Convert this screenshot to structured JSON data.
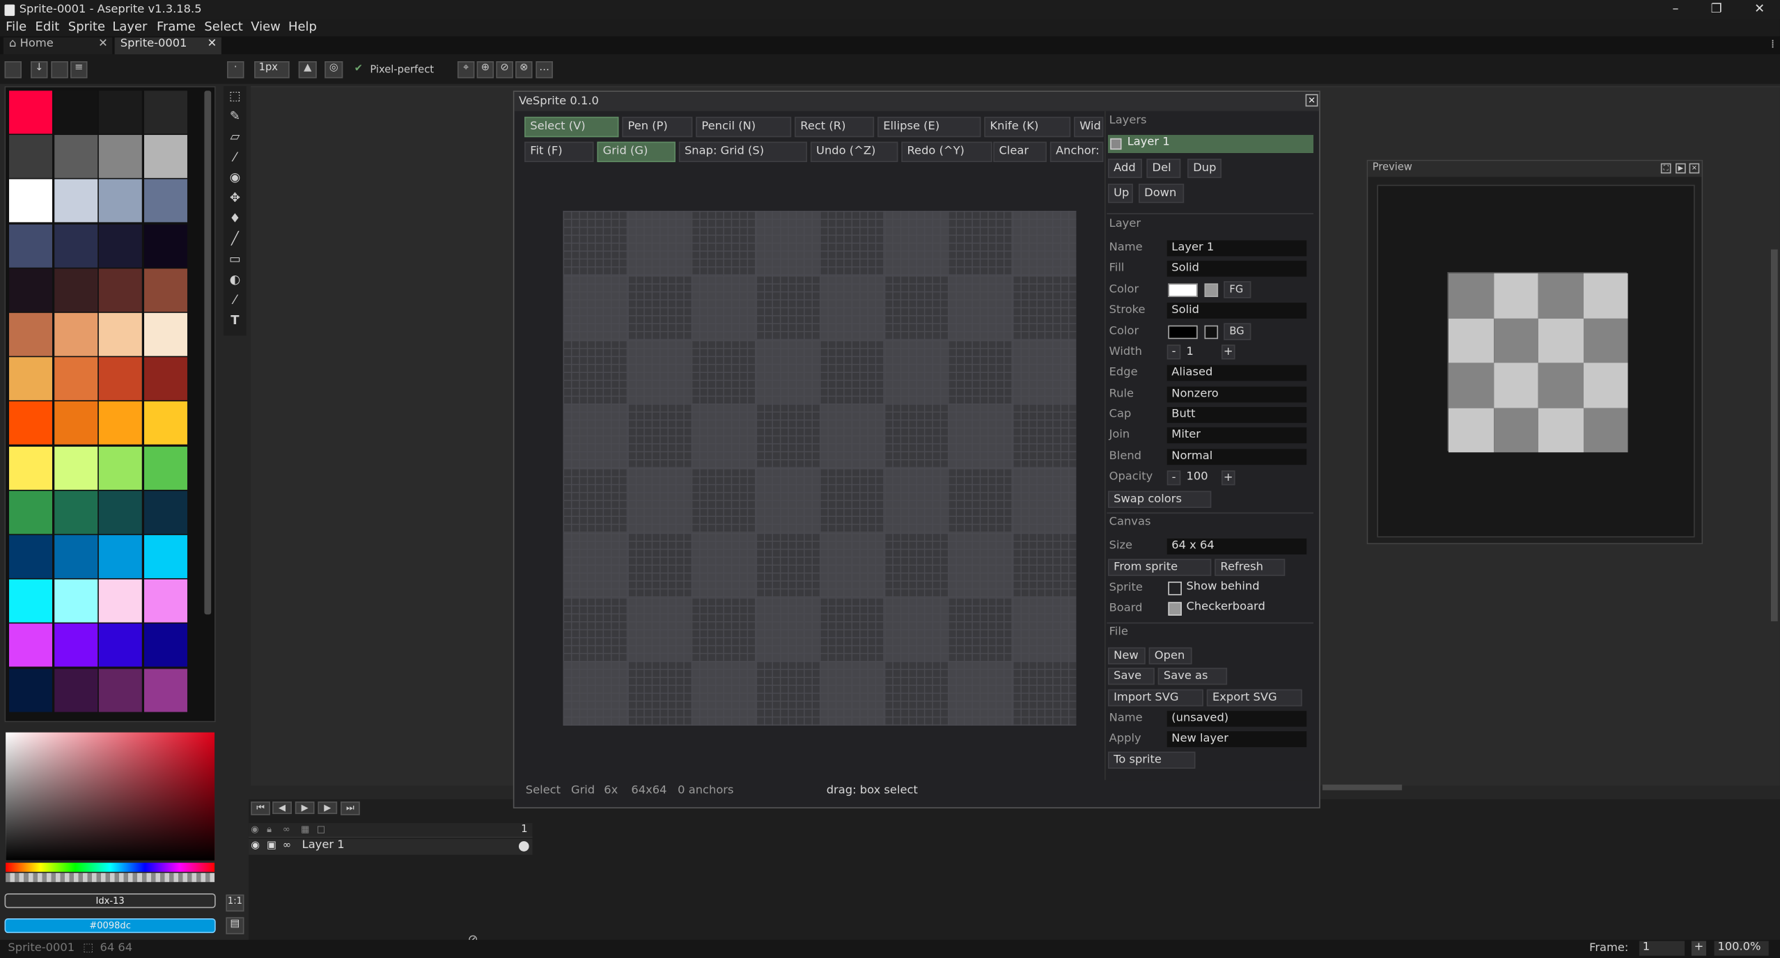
{
  "window": {
    "title": "Sprite-0001 - Aseprite v1.3.18.5",
    "controls": [
      "–",
      "❐",
      "✕"
    ]
  },
  "menu": [
    "File",
    "Edit",
    "Sprite",
    "Layer",
    "Frame",
    "Select",
    "View",
    "Help"
  ],
  "tabs": [
    {
      "label": "Home",
      "icon": "home-icon"
    },
    {
      "label": "Sprite-0001"
    }
  ],
  "toolbar": {
    "brush_size": "1px",
    "pixel_perfect_label": "Pixel-perfect"
  },
  "palette": [
    "#ff0040",
    "#131313",
    "#1b1b1b",
    "#272727",
    "#3d3d3d",
    "#5d5d5d",
    "#858585",
    "#b4b4b4",
    "#ffffff",
    "#c7cfdd",
    "#92a1b9",
    "#657392",
    "#424c6e",
    "#2a2f4e",
    "#1a1932",
    "#0e071b",
    "#1c121c",
    "#391f21",
    "#5d2c28",
    "#8a4836",
    "#bf6f4a",
    "#e69c69",
    "#f6ca9f",
    "#f9e6cf",
    "#edab50",
    "#e07438",
    "#c64524",
    "#8e251d",
    "#ff5000",
    "#ed7614",
    "#ffa214",
    "#ffc825",
    "#ffeb57",
    "#d3fc7e",
    "#99e65f",
    "#5ac54f",
    "#33984b",
    "#1e6f50",
    "#134c4c",
    "#0c2e44",
    "#00396d",
    "#0069aa",
    "#0098dc",
    "#00cdf9",
    "#0cf1ff",
    "#94fdff",
    "#fdd2ed",
    "#f389f5",
    "#db3ffd",
    "#7a09fa",
    "#3003d9",
    "#0c0293",
    "#03193f",
    "#3b1443",
    "#622461",
    "#93388f"
  ],
  "color_fields": {
    "index": "Idx-13",
    "hex": "#0098dc"
  },
  "status": {
    "sprite": "Sprite-0001",
    "size": "64 64",
    "frame_label": "Frame:",
    "frame_value": "1",
    "zoom": "100.0%"
  },
  "timeline": {
    "layer_name": "Layer 1",
    "frame_number": "1"
  },
  "dialog": {
    "title": "VeSprite 0.1.0",
    "tools_row1": [
      {
        "label": "Select (V)",
        "active": true
      },
      {
        "label": "Pen (P)"
      },
      {
        "label": "Pencil (N)"
      },
      {
        "label": "Rect (R)"
      },
      {
        "label": "Ellipse (E)"
      },
      {
        "label": "Knife (K)"
      },
      {
        "label": "Wid"
      }
    ],
    "tools_row2": [
      {
        "label": "Fit (F)"
      },
      {
        "label": "Grid (G)",
        "active": true
      },
      {
        "label": "Snap: Grid (S)"
      },
      {
        "label": "Undo (^Z)"
      },
      {
        "label": "Redo (^Y)"
      },
      {
        "label": "Clear"
      },
      {
        "label": "Anchor:"
      }
    ],
    "status_line": {
      "mode": "Select",
      "grid": "Grid",
      "zoom": "6x",
      "size": "64x64",
      "anchors": "0 anchors",
      "hint": "drag: box select"
    },
    "layers": {
      "header": "Layers",
      "items": [
        "Layer 1"
      ],
      "buttons": [
        "Add",
        "Del",
        "Dup",
        "Up",
        "Down"
      ]
    },
    "layer_props": {
      "header": "Layer",
      "name_label": "Name",
      "name_value": "Layer 1",
      "fill_label": "Fill",
      "fill_value": "Solid",
      "color_label": "Color",
      "fill_color": "#ffffff",
      "fg_label": "FG",
      "stroke_label": "Stroke",
      "stroke_value": "Solid",
      "stroke_color_label": "Color",
      "stroke_color": "#000000",
      "bg_label": "BG",
      "width_label": "Width",
      "width_value": "1",
      "edge_label": "Edge",
      "edge_value": "Aliased",
      "rule_label": "Rule",
      "rule_value": "Nonzero",
      "cap_label": "Cap",
      "cap_value": "Butt",
      "join_label": "Join",
      "join_value": "Miter",
      "blend_label": "Blend",
      "blend_value": "Normal",
      "opacity_label": "Opacity",
      "opacity_value": "100",
      "swap_label": "Swap colors",
      "minus": "-",
      "plus": "+"
    },
    "canvas": {
      "header": "Canvas",
      "size_label": "Size",
      "size_value": "64 x 64",
      "from_sprite": "From sprite",
      "refresh": "Refresh",
      "sprite_label": "Sprite",
      "show_behind": "Show behind",
      "board_label": "Board",
      "checkerboard": "Checkerboard"
    },
    "file": {
      "header": "File",
      "new": "New",
      "open": "Open",
      "save": "Save",
      "save_as": "Save as",
      "import": "Import SVG",
      "export": "Export SVG",
      "name_label": "Name",
      "name_value": "(unsaved)",
      "apply_label": "Apply",
      "apply_value": "New layer",
      "to_sprite": "To sprite"
    }
  },
  "preview": {
    "title": "Preview"
  }
}
